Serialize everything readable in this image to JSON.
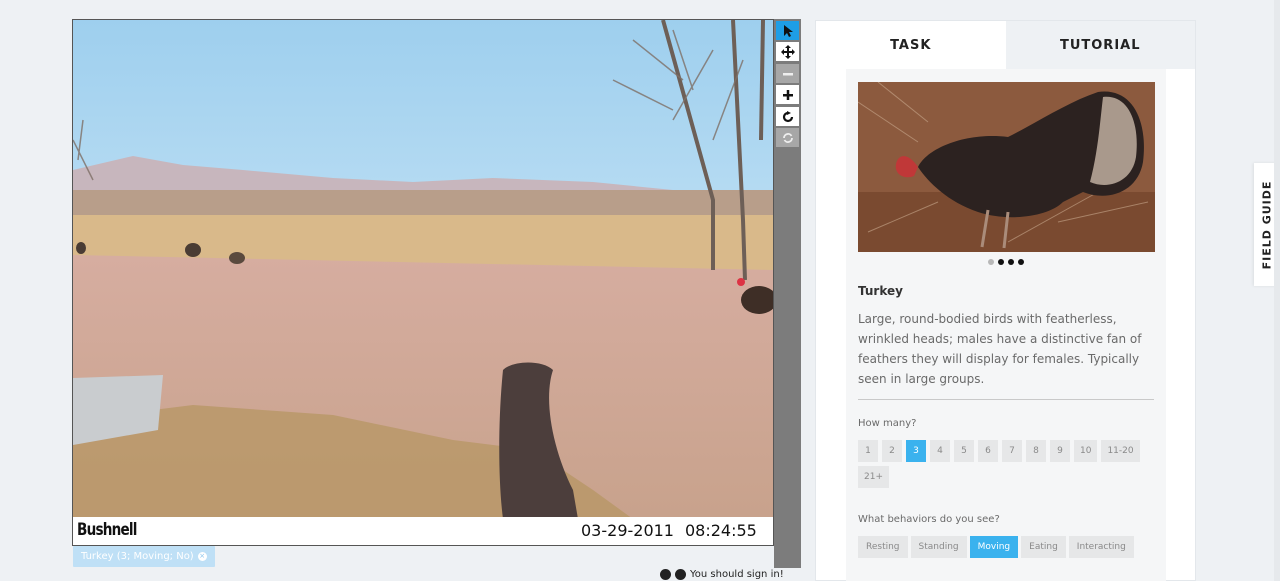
{
  "camera": {
    "brand": "Bushnell",
    "date": "03-29-2011",
    "time": "08:24:55"
  },
  "toolbar": {
    "tools": [
      {
        "name": "pointer-icon",
        "state": "active"
      },
      {
        "name": "pan-icon",
        "state": "normal"
      },
      {
        "name": "zoom-out-icon",
        "state": "disabled"
      },
      {
        "name": "zoom-in-icon",
        "state": "normal"
      },
      {
        "name": "rotate-icon",
        "state": "normal"
      },
      {
        "name": "reset-icon",
        "state": "disabled"
      }
    ]
  },
  "annotation": {
    "label": "Turkey (3; Moving; No)",
    "close_icon": "close-icon"
  },
  "footer": {
    "signin_text": "You should sign in!"
  },
  "tabs": {
    "task": "TASK",
    "tutorial": "TUTORIAL"
  },
  "species": {
    "name": "Turkey",
    "description": "Large, round-bodied birds with featherless, wrinkled heads; males have a distinctive fan of feathers they will display for females. Typically seen in large groups.",
    "carousel_count": 4,
    "carousel_active": 0
  },
  "questions": {
    "how_many_label": "How many?",
    "counts": [
      "1",
      "2",
      "3",
      "4",
      "5",
      "6",
      "7",
      "8",
      "9",
      "10",
      "11-20",
      "21+"
    ],
    "count_selected": "3",
    "behaviors_label": "What behaviors do you see?",
    "behaviors": [
      "Resting",
      "Standing",
      "Moving",
      "Eating",
      "Interacting"
    ],
    "behavior_selected": "Moving"
  },
  "field_guide": {
    "label": "FIELD GUIDE"
  },
  "colors": {
    "accent": "#3ab2ee",
    "toolbar": "#7c7c7c",
    "background": "#eef1f4"
  }
}
